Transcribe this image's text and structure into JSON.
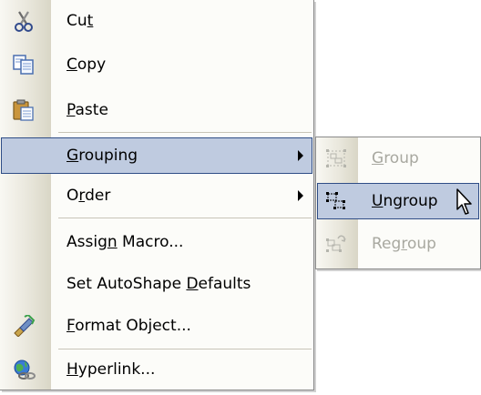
{
  "main_menu": {
    "items": [
      {
        "pre": "Cu",
        "key": "t",
        "post": "",
        "icon": "scissors-icon"
      },
      {
        "pre": "",
        "key": "C",
        "post": "opy",
        "icon": "copy-icon"
      },
      {
        "pre": "",
        "key": "P",
        "post": "aste",
        "icon": "paste-icon"
      },
      {
        "pre": "",
        "key": "G",
        "post": "rouping",
        "submenu": true
      },
      {
        "pre": "O",
        "key": "r",
        "post": "der",
        "submenu": true
      },
      {
        "pre": "Assig",
        "key": "n",
        "post": " Macro..."
      },
      {
        "pre": "Set AutoShape ",
        "key": "D",
        "post": "efaults"
      },
      {
        "pre": "",
        "key": "F",
        "post": "ormat Object...",
        "icon": "format-object-icon"
      },
      {
        "pre": "",
        "key": "H",
        "post": "yperlink...",
        "icon": "hyperlink-icon"
      }
    ]
  },
  "sub_menu": {
    "items": [
      {
        "pre": "",
        "key": "G",
        "post": "roup",
        "disabled": true,
        "icon": "group-icon"
      },
      {
        "pre": "",
        "key": "U",
        "post": "ngroup",
        "icon": "ungroup-icon"
      },
      {
        "pre": "Reg",
        "key": "r",
        "post": "oup",
        "disabled": true,
        "icon": "regroup-icon"
      }
    ]
  },
  "colors": {
    "highlight": "#bfcbe0",
    "highlight_border": "#2f4d86"
  }
}
